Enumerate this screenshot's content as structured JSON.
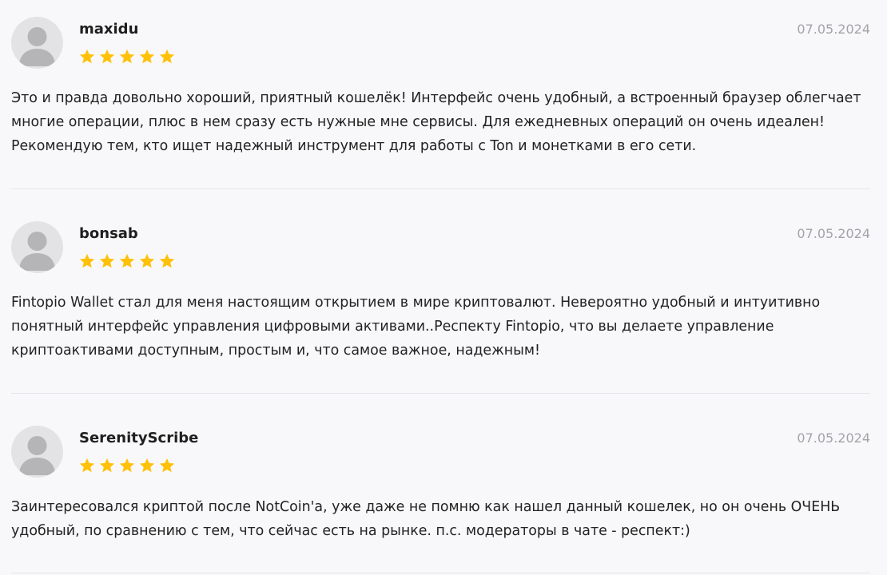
{
  "reviews": [
    {
      "author": "maxidu",
      "date": "07.05.2024",
      "rating": 5,
      "text": "Это и правда довольно хороший, приятный кошелёк! Интерфейс очень удобный, а встроенный браузер облегчает многие операции, плюс в нем сразу есть нужные мне сервисы. Для ежедневных операций он очень идеален! Рекомендую тем, кто ищет надежный инструмент для работы с Ton и монетками в его сети."
    },
    {
      "author": "bonsab",
      "date": "07.05.2024",
      "rating": 5,
      "text": "Fintopio Wallet стал для меня настоящим открытием в мире криптовалют. Невероятно удобный и интуитивно понятный интерфейс управления цифровыми активами..Респекту Fintopio, что вы делаете управление криптоактивами доступным, простым и, что самое важное, надежным!"
    },
    {
      "author": "SerenityScribe",
      "date": "07.05.2024",
      "rating": 5,
      "text": "Заинтересовался криптой после NotCoin'a, уже даже не помню как нашел данный кошелек, но он очень ОЧЕНЬ удобный, по сравнению с тем, что сейчас есть на рынке. п.с. модераторы в чате - респект:)"
    }
  ],
  "icons": {
    "avatar": "user-silhouette-icon",
    "star": "star-filled-icon"
  },
  "colors": {
    "star": "#FFC107",
    "avatar_bg": "#E3E3E5",
    "avatar_fg": "#B5B5B8",
    "date": "#A3A3A8",
    "divider": "#E6E6EA",
    "background": "#F8F8FA"
  }
}
